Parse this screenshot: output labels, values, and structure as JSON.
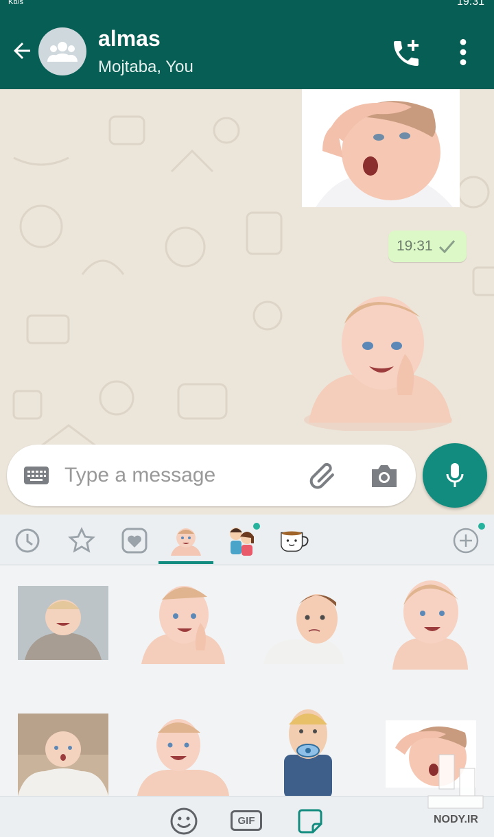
{
  "status_bar": {
    "left_text": "Kb/s",
    "time": "19:31"
  },
  "header": {
    "title": "almas",
    "subtitle": "Mojtaba, You",
    "back_icon": "arrow-left-icon",
    "avatar_icon": "group-icon",
    "call_icon": "add-call-icon",
    "menu_icon": "more-vert-icon"
  },
  "messages": [
    {
      "type": "sticker",
      "subject": "baby-surprised"
    },
    {
      "type": "time",
      "time": "19:31",
      "status": "read"
    },
    {
      "type": "sticker",
      "subject": "baby-smiling"
    }
  ],
  "input": {
    "placeholder": "Type a message",
    "keyboard_icon": "keyboard-icon",
    "attach_icon": "paperclip-icon",
    "camera_icon": "camera-icon",
    "mic_icon": "mic-icon"
  },
  "sticker_tabs": [
    {
      "icon": "clock-icon",
      "name": "recent"
    },
    {
      "icon": "star-icon",
      "name": "favorites"
    },
    {
      "icon": "heart-icon",
      "name": "love"
    },
    {
      "icon": "baby-pack-icon",
      "name": "baby-pack",
      "selected": true
    },
    {
      "icon": "couple-pack-icon",
      "name": "couple-pack",
      "new": true
    },
    {
      "icon": "cup-pack-icon",
      "name": "cup-pack"
    },
    {
      "icon": "add-icon",
      "name": "add-pack",
      "new": true
    }
  ],
  "sticker_grid": [
    "baby-sweater",
    "baby-hand-cheek",
    "baby-thinking",
    "baby-smile",
    "baby-blanket",
    "baby-laughing",
    "baby-pacifier",
    "baby-forehead"
  ],
  "bottom_bar": [
    {
      "icon": "emoji-icon"
    },
    {
      "icon": "gif-icon",
      "label": "GIF"
    },
    {
      "icon": "sticker-icon"
    }
  ],
  "watermark": {
    "text": "NODY.IR"
  },
  "colors": {
    "header": "#075e54",
    "accent": "#128c7e",
    "bubble_out": "#dcf8c6"
  }
}
